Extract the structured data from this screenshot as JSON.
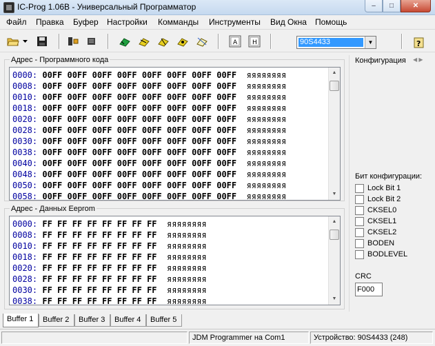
{
  "window": {
    "title": "IC-Prog 1.06B - Универсальный Программатор",
    "minimize": "–",
    "maximize": "□",
    "close": "✕"
  },
  "menu": [
    "Файл",
    "Правка",
    "Буфер",
    "Настройки",
    "Комманды",
    "Инструменты",
    "Вид Окна",
    "Помощь"
  ],
  "toolbar": {
    "device": "90S4433"
  },
  "program_section": {
    "label": "Адрес - Программного кода",
    "rows": [
      {
        "addr": "0000:",
        "values": "00FF 00FF 00FF 00FF 00FF 00FF 00FF 00FF",
        "ascii": "яяяяяяяя"
      },
      {
        "addr": "0008:",
        "values": "00FF 00FF 00FF 00FF 00FF 00FF 00FF 00FF",
        "ascii": "яяяяяяяя"
      },
      {
        "addr": "0010:",
        "values": "00FF 00FF 00FF 00FF 00FF 00FF 00FF 00FF",
        "ascii": "яяяяяяяя"
      },
      {
        "addr": "0018:",
        "values": "00FF 00FF 00FF 00FF 00FF 00FF 00FF 00FF",
        "ascii": "яяяяяяяя"
      },
      {
        "addr": "0020:",
        "values": "00FF 00FF 00FF 00FF 00FF 00FF 00FF 00FF",
        "ascii": "яяяяяяяя"
      },
      {
        "addr": "0028:",
        "values": "00FF 00FF 00FF 00FF 00FF 00FF 00FF 00FF",
        "ascii": "яяяяяяяя"
      },
      {
        "addr": "0030:",
        "values": "00FF 00FF 00FF 00FF 00FF 00FF 00FF 00FF",
        "ascii": "яяяяяяяя"
      },
      {
        "addr": "0038:",
        "values": "00FF 00FF 00FF 00FF 00FF 00FF 00FF 00FF",
        "ascii": "яяяяяяяя"
      },
      {
        "addr": "0040:",
        "values": "00FF 00FF 00FF 00FF 00FF 00FF 00FF 00FF",
        "ascii": "яяяяяяяя"
      },
      {
        "addr": "0048:",
        "values": "00FF 00FF 00FF 00FF 00FF 00FF 00FF 00FF",
        "ascii": "яяяяяяяя"
      },
      {
        "addr": "0050:",
        "values": "00FF 00FF 00FF 00FF 00FF 00FF 00FF 00FF",
        "ascii": "яяяяяяяя"
      },
      {
        "addr": "0058:",
        "values": "00FF 00FF 00FF 00FF 00FF 00FF 00FF 00FF",
        "ascii": "яяяяяяяя"
      }
    ]
  },
  "eeprom_section": {
    "label": "Адрес - Данных Eeprom",
    "rows": [
      {
        "addr": "0000:",
        "values": "FF FF FF FF FF FF FF FF",
        "ascii": "яяяяяяяя"
      },
      {
        "addr": "0008:",
        "values": "FF FF FF FF FF FF FF FF",
        "ascii": "яяяяяяяя"
      },
      {
        "addr": "0010:",
        "values": "FF FF FF FF FF FF FF FF",
        "ascii": "яяяяяяяя"
      },
      {
        "addr": "0018:",
        "values": "FF FF FF FF FF FF FF FF",
        "ascii": "яяяяяяяя"
      },
      {
        "addr": "0020:",
        "values": "FF FF FF FF FF FF FF FF",
        "ascii": "яяяяяяяя"
      },
      {
        "addr": "0028:",
        "values": "FF FF FF FF FF FF FF FF",
        "ascii": "яяяяяяяя"
      },
      {
        "addr": "0030:",
        "values": "FF FF FF FF FF FF FF FF",
        "ascii": "яяяяяяяя"
      },
      {
        "addr": "0038:",
        "values": "FF FF FF FF FF FF FF FF",
        "ascii": "яяяяяяяя"
      }
    ]
  },
  "config": {
    "header": "Конфигурация",
    "bits_title": "Бит конфигурации:",
    "bits": [
      "Lock Bit 1",
      "Lock Bit 2",
      "CKSEL0",
      "CKSEL1",
      "CKSEL2",
      "BODEN",
      "BODLEVEL"
    ],
    "crc_label": "CRC",
    "crc_value": "F000"
  },
  "tabs": [
    "Buffer 1",
    "Buffer 2",
    "Buffer 3",
    "Buffer 4",
    "Buffer 5"
  ],
  "status": {
    "programmer": "JDM Programmer на Com1",
    "device": "Устройство: 90S4433  (248)"
  },
  "colors": {
    "address": "#0000a0",
    "selection": "#3399ff"
  },
  "icons": [
    "open-folder-icon",
    "save-icon",
    "read-icon",
    "write-icon",
    "erase-icon",
    "verify-icon",
    "blank-check-icon",
    "view-ascii-icon",
    "view-hex-icon",
    "help-icon"
  ]
}
